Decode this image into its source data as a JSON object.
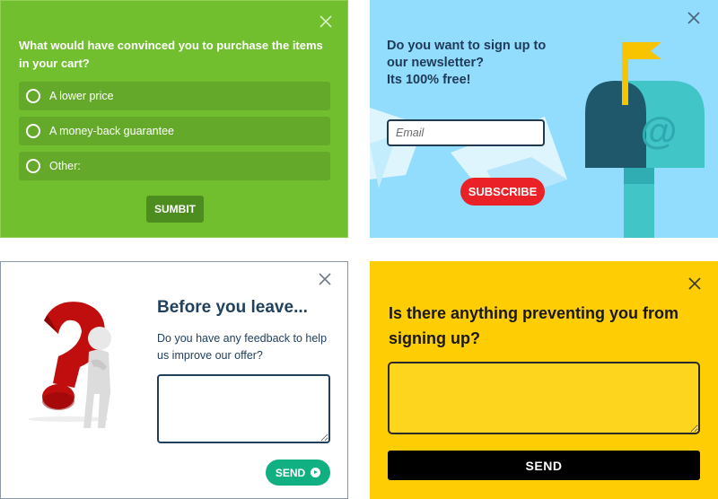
{
  "panel1": {
    "question": "What would have convinced you to purchase the items in your cart?",
    "options": [
      {
        "label": "A lower price"
      },
      {
        "label": "A money-back guarantee"
      },
      {
        "label": "Other:"
      }
    ],
    "submit_label": "SUMBIT",
    "colors": {
      "background": "#71bf2e",
      "option": "#64a929",
      "button": "#4d8c1f"
    }
  },
  "panel2": {
    "question_lines": [
      "Do you want to sign up to",
      "our newsletter?",
      "Its 100% free!"
    ],
    "email_placeholder": "Email",
    "subscribe_label": "SUBSCRIBE",
    "illustration": "mailbox-icon",
    "mailbox_symbol": "@",
    "colors": {
      "background": "#92dcfd",
      "button": "#ea2127",
      "mailbox": "#41c5c7",
      "flag": "#f8c400"
    }
  },
  "panel3": {
    "title": "Before you leave...",
    "subtitle": "Do you have any feedback to help us improve our offer?",
    "send_label": "SEND",
    "illustration": "question-mark-figure",
    "colors": {
      "text": "#22415e",
      "button": "#11b083"
    }
  },
  "panel4": {
    "question": "Is there anything preventing you from signing up?",
    "send_label": "SEND",
    "colors": {
      "background": "#fecd04",
      "button": "#000000"
    }
  }
}
